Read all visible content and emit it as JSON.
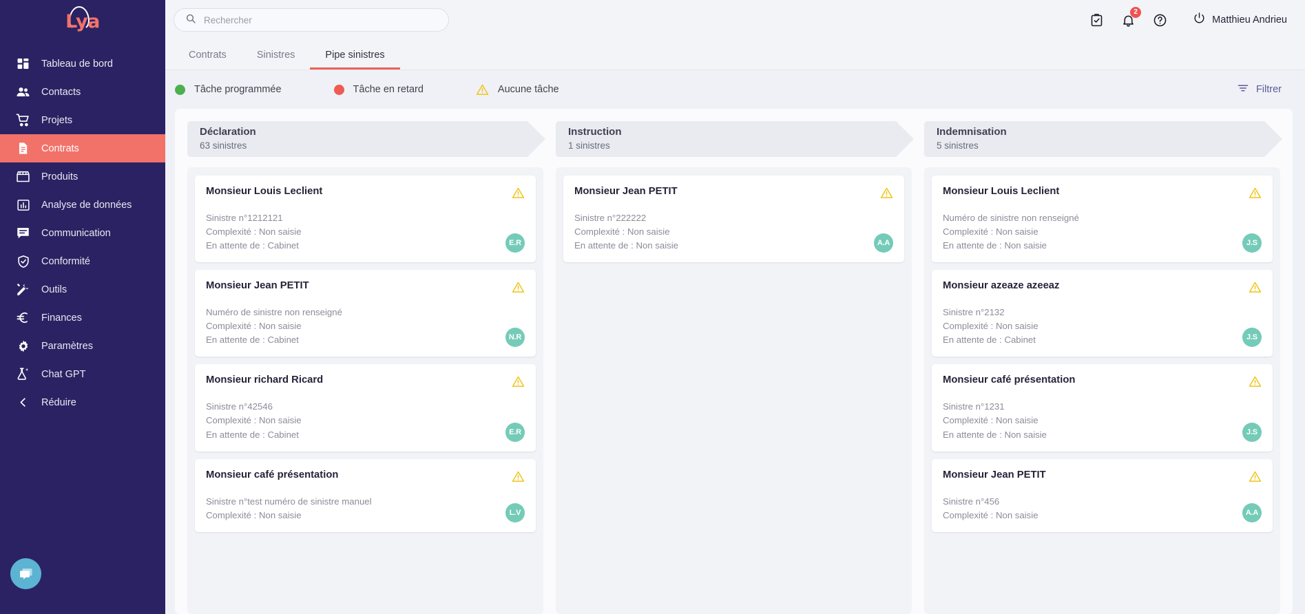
{
  "brand": {
    "logo_text": "Lya",
    "accent": "#f2726a",
    "sidebar_bg": "#2b2263"
  },
  "sidebar": {
    "items": [
      {
        "label": "Tableau de bord",
        "icon": "dashboard-icon",
        "active": false
      },
      {
        "label": "Contacts",
        "icon": "contacts-icon",
        "active": false
      },
      {
        "label": "Projets",
        "icon": "cart-icon",
        "active": false
      },
      {
        "label": "Contrats",
        "icon": "document-icon",
        "active": true
      },
      {
        "label": "Produits",
        "icon": "store-icon",
        "active": false
      },
      {
        "label": "Analyse de données",
        "icon": "chart-icon",
        "active": false
      },
      {
        "label": "Communication",
        "icon": "chat-icon",
        "active": false
      },
      {
        "label": "Conformité",
        "icon": "shield-check-icon",
        "active": false
      },
      {
        "label": "Outils",
        "icon": "tools-icon",
        "active": false
      },
      {
        "label": "Finances",
        "icon": "euro-icon",
        "active": false
      },
      {
        "label": "Paramètres",
        "icon": "gear-icon",
        "active": false
      },
      {
        "label": "Chat GPT",
        "icon": "flask-sparkle-icon",
        "active": false
      },
      {
        "label": "Réduire",
        "icon": "chevron-left-icon",
        "active": false
      }
    ],
    "chat_widget_icon": "chat-bubble-icon"
  },
  "topbar": {
    "search": {
      "placeholder": "Rechercher",
      "value": ""
    },
    "icons": [
      {
        "name": "clipboard-check-icon"
      },
      {
        "name": "bell-icon",
        "badge": "2"
      },
      {
        "name": "help-circle-icon"
      }
    ],
    "user": {
      "name": "Matthieu Andrieu",
      "icon": "power-icon"
    }
  },
  "tabs": [
    {
      "label": "Contrats",
      "active": false
    },
    {
      "label": "Sinistres",
      "active": false
    },
    {
      "label": "Pipe sinistres",
      "active": true
    }
  ],
  "legend": {
    "items": [
      {
        "label": "Tâche programmée",
        "marker": "dot",
        "color": "#4caf50"
      },
      {
        "label": "Tâche en retard",
        "marker": "dot",
        "color": "#ef5b52"
      },
      {
        "label": "Aucune tâche",
        "marker": "warning-triangle-icon",
        "color": "#f5c518"
      }
    ],
    "filter": {
      "label": "Filtrer",
      "icon": "filter-icon"
    }
  },
  "board": {
    "columns": [
      {
        "title": "Déclaration",
        "count": "63 sinistres",
        "cards": [
          {
            "name": "Monsieur Louis Leclient",
            "line1": "Sinistre n°1212121",
            "line2": "Complexité : Non saisie",
            "line3": "En attente de : Cabinet",
            "avatar": "E.R",
            "status_icon": "warning-triangle-icon"
          },
          {
            "name": "Monsieur Jean PETIT",
            "line1": "Numéro de sinistre non renseigné",
            "line2": "Complexité : Non saisie",
            "line3": "En attente de : Cabinet",
            "avatar": "N.R",
            "status_icon": "warning-triangle-icon"
          },
          {
            "name": "Monsieur richard Ricard",
            "line1": "Sinistre n°42546",
            "line2": "Complexité : Non saisie",
            "line3": "En attente de : Cabinet",
            "avatar": "E.R",
            "status_icon": "warning-triangle-icon"
          },
          {
            "name": "Monsieur café présentation",
            "line1": "Sinistre n°test numéro de sinistre manuel",
            "line2": "Complexité : Non saisie",
            "line3": "",
            "avatar": "L.V",
            "status_icon": "warning-triangle-icon"
          }
        ]
      },
      {
        "title": "Instruction",
        "count": "1 sinistres",
        "cards": [
          {
            "name": "Monsieur Jean PETIT",
            "line1": "Sinistre n°222222",
            "line2": "Complexité : Non saisie",
            "line3": "En attente de : Non saisie",
            "avatar": "A.A",
            "status_icon": "warning-triangle-icon"
          }
        ]
      },
      {
        "title": "Indemnisation",
        "count": "5 sinistres",
        "cards": [
          {
            "name": "Monsieur Louis Leclient",
            "line1": "Numéro de sinistre non renseigné",
            "line2": "Complexité : Non saisie",
            "line3": "En attente de : Non saisie",
            "avatar": "J.S",
            "status_icon": "warning-triangle-icon"
          },
          {
            "name": "Monsieur azeaze azeeaz",
            "line1": "Sinistre n°2132",
            "line2": "Complexité : Non saisie",
            "line3": "En attente de : Cabinet",
            "avatar": "J.S",
            "status_icon": "warning-triangle-icon"
          },
          {
            "name": "Monsieur café présentation",
            "line1": "Sinistre n°1231",
            "line2": "Complexité : Non saisie",
            "line3": "En attente de : Non saisie",
            "avatar": "J.S",
            "status_icon": "warning-triangle-icon"
          },
          {
            "name": "Monsieur Jean PETIT",
            "line1": "Sinistre n°456",
            "line2": "Complexité : Non saisie",
            "line3": "",
            "avatar": "A.A",
            "status_icon": "warning-triangle-icon"
          }
        ]
      }
    ]
  }
}
